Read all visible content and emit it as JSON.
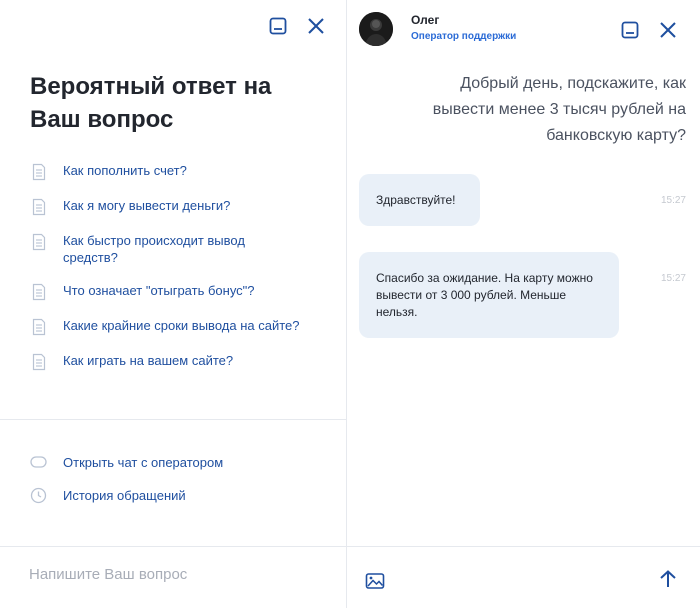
{
  "left_panel": {
    "title": "Вероятный ответ на Ваш вопрос",
    "faq": [
      "Как пополнить счет?",
      "Как я могу вывести деньги?",
      "Как быстро происходит вывод средств?",
      "Что означает \"отыграть бонус\"?",
      "Какие крайние сроки вывода на сайте?",
      "Как играть на вашем сайте?"
    ],
    "links": {
      "open_chat": "Открыть чат с оператором",
      "history": "История обращений"
    },
    "input_placeholder": "Напишите Ваш вопрос"
  },
  "right_panel": {
    "operator_name": "Олег",
    "operator_role": "Оператор поддержки",
    "user_message": "Добрый день, подскажите, как вывести менее 3 тысяч рублей на банковскую карту?",
    "messages": [
      {
        "text": "Здравствуйте!",
        "time": "15:27"
      },
      {
        "text": "Спасибо за ожидание. На карту можно вывести от 3 000 рублей. Меньше нельзя.",
        "time": "15:27"
      }
    ]
  },
  "colors": {
    "accent": "#1f4f9f",
    "role": "#2b6bd6",
    "bubble": "#e9f0f8",
    "divider": "#e6e9ee"
  },
  "icons": [
    "minimize-icon",
    "close-icon",
    "document-icon",
    "chat-bubble-icon",
    "clock-icon",
    "image-icon",
    "send-arrow-icon"
  ]
}
